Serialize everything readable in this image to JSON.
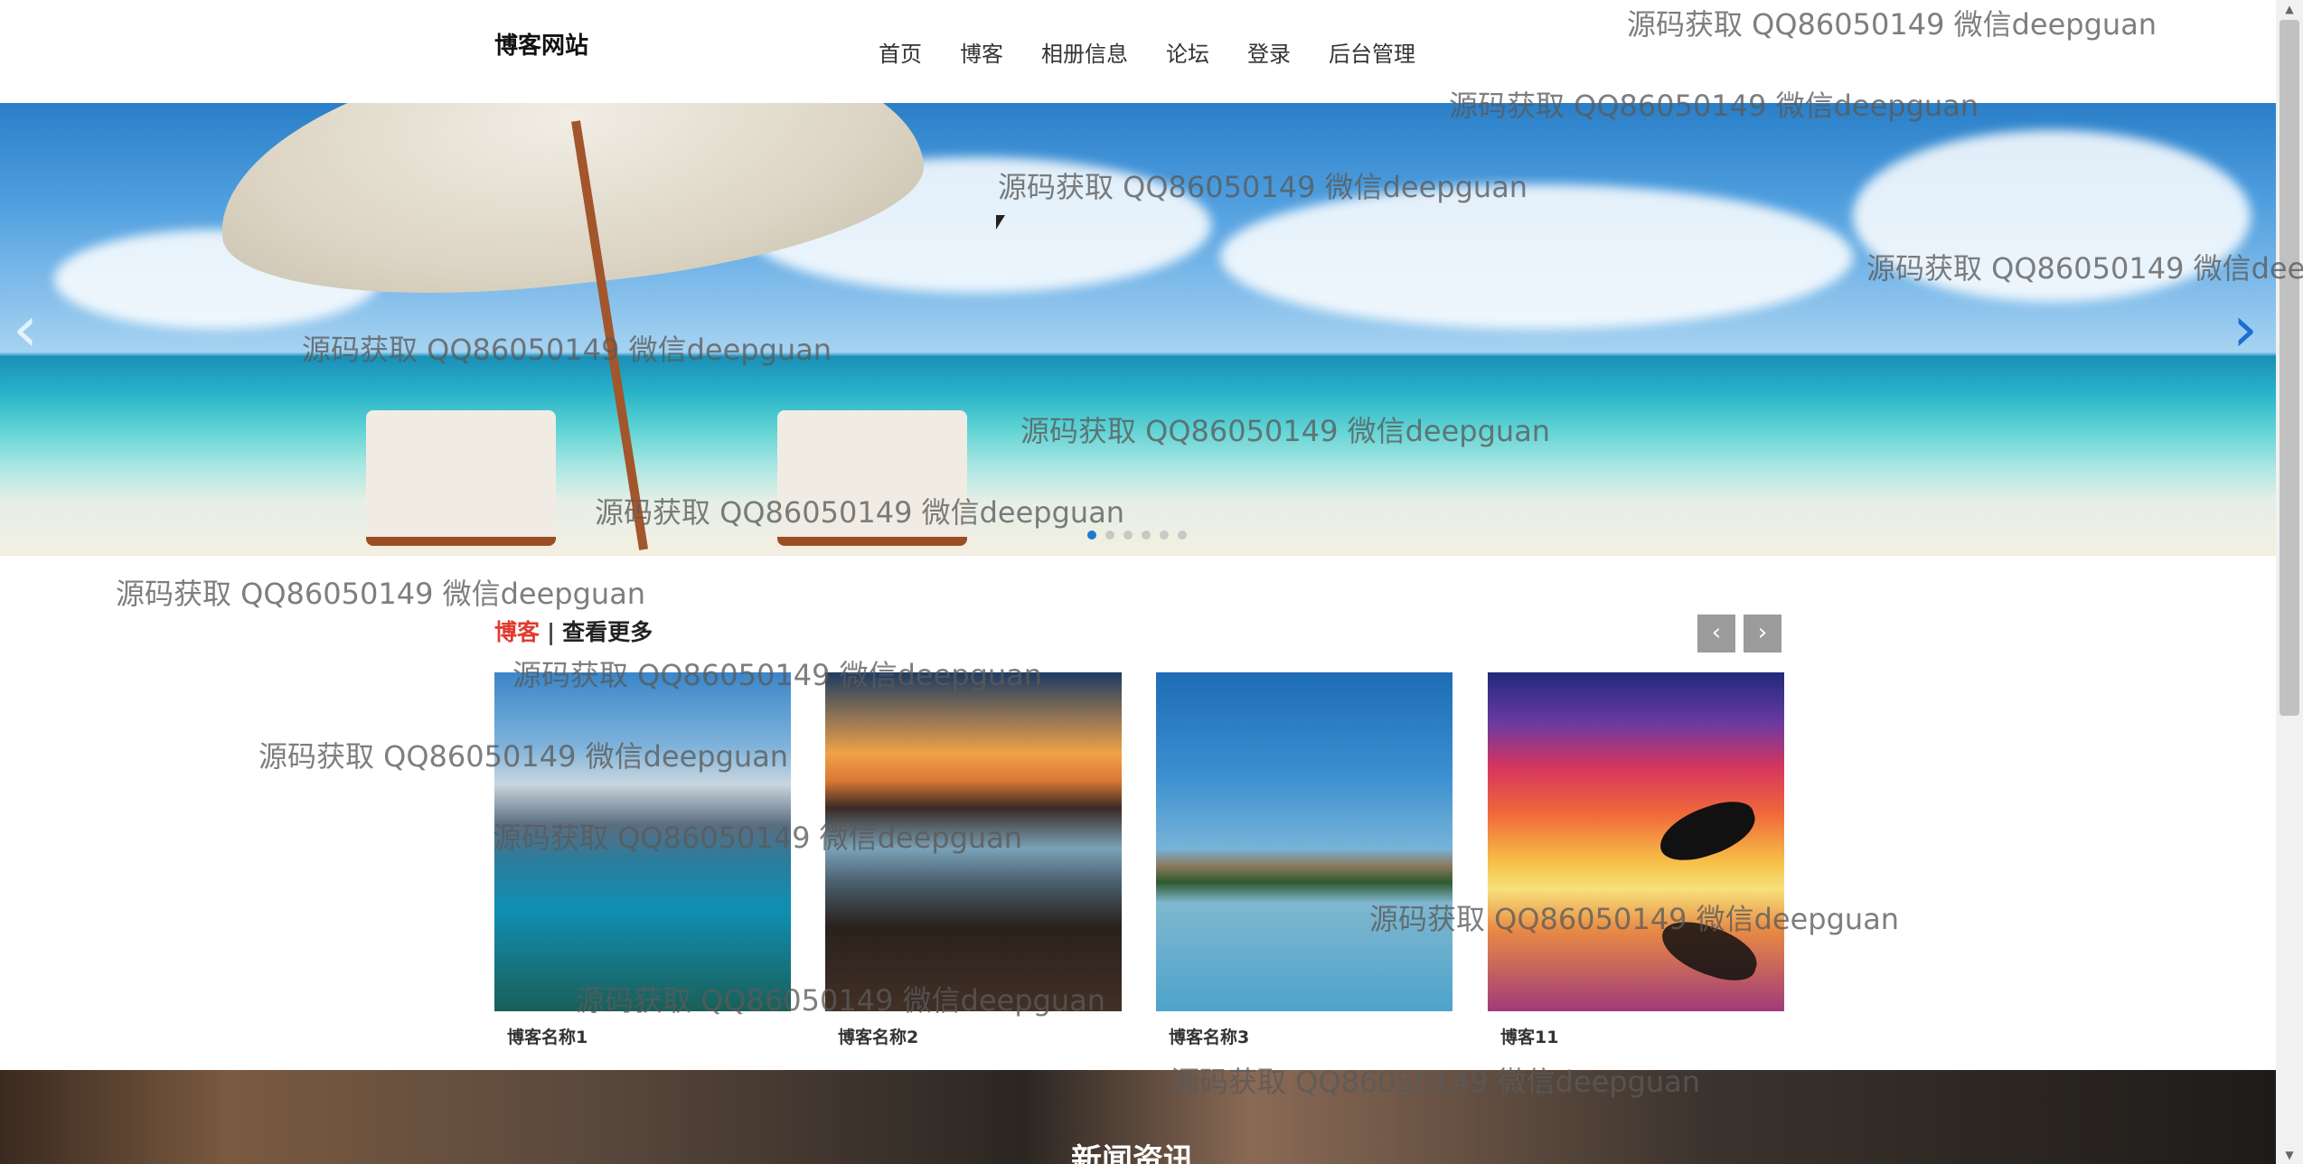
{
  "header": {
    "site_title": "博客网站",
    "nav": [
      "首页",
      "博客",
      "相册信息",
      "论坛",
      "登录",
      "后台管理"
    ]
  },
  "banner": {
    "prev_icon": "chevron-left-icon",
    "next_icon": "chevron-right-icon",
    "slide_count": 6,
    "active_slide": 1
  },
  "blog_section": {
    "title": "博客",
    "separator": "|",
    "more_label": "查看更多",
    "prev_label": "‹",
    "next_label": "›",
    "cards": [
      {
        "name": "博客名称1"
      },
      {
        "name": "博客名称2"
      },
      {
        "name": "博客名称3"
      },
      {
        "name": "博客11"
      }
    ]
  },
  "news_section": {
    "title": "新闻资讯"
  },
  "watermark": "源码获取 QQ86050149 微信deepguan",
  "colors": {
    "accent": "#e23a2e",
    "active_dot": "#1f78d1"
  }
}
